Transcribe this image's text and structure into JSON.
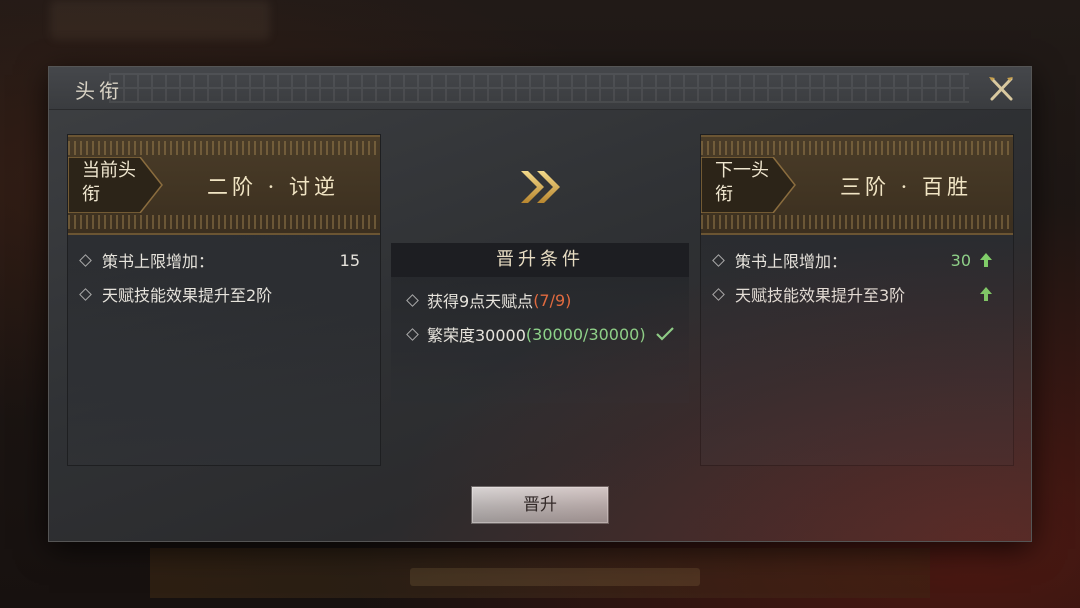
{
  "dialog": {
    "title": "头衔"
  },
  "current": {
    "tag": "当前头衔",
    "rank": "二阶 · 讨逆",
    "attributes": [
      {
        "label": "策书上限增加：",
        "value": "15"
      },
      {
        "label": "天赋技能效果提升至2阶",
        "value": ""
      }
    ]
  },
  "next": {
    "tag": "下一头衔",
    "rank": "三阶 · 百胜",
    "attributes": [
      {
        "label": "策书上限增加：",
        "value": "30",
        "trend": "up"
      },
      {
        "label": "天赋技能效果提升至3阶",
        "value": "",
        "trend": "up"
      }
    ]
  },
  "conditions": {
    "header": "晋升条件",
    "items": [
      {
        "label": "获得9点天赋点",
        "progress": "(7/9)",
        "status": "incomplete"
      },
      {
        "label": "繁荣度30000",
        "progress": "(30000/30000)",
        "status": "complete"
      }
    ]
  },
  "promote_button": "晋升",
  "colors": {
    "gold": "#c9a24e",
    "progress_incomplete": "#e06a3f",
    "progress_complete": "#8ed38a"
  },
  "icons": {
    "close": "crossed-swords-close-icon",
    "advance": "double-chevron-right-icon",
    "up": "green-up-arrow-icon",
    "done": "check-icon"
  }
}
